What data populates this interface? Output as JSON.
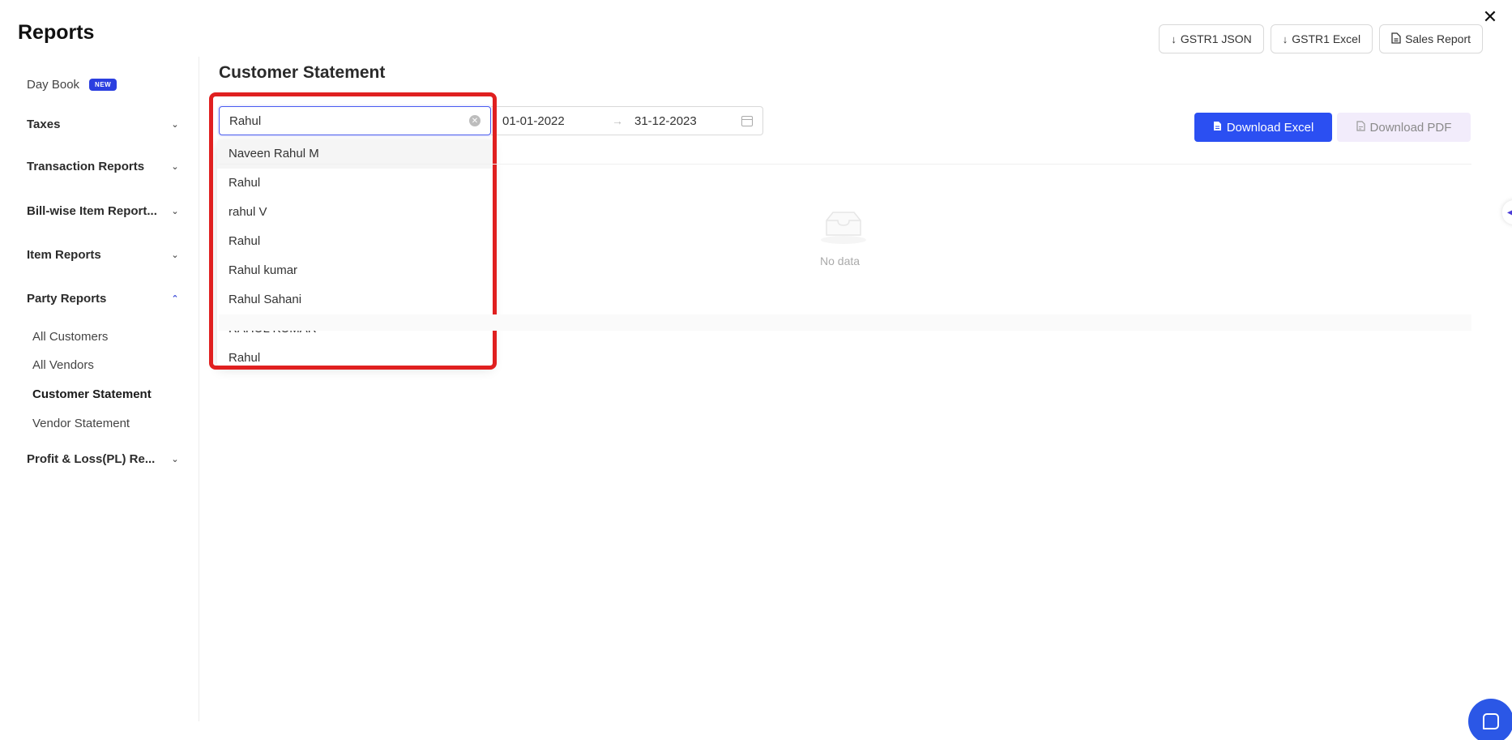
{
  "header": {
    "title": "Reports",
    "close_symbol": "✕",
    "actions": [
      {
        "label": "GSTR1 JSON",
        "icon": "download-arrow-icon"
      },
      {
        "label": "GSTR1 Excel",
        "icon": "download-arrow-icon"
      },
      {
        "label": "Sales Report",
        "icon": "document-icon"
      }
    ]
  },
  "sidebar": {
    "day_book": {
      "label": "Day Book",
      "badge": "NEW"
    },
    "sections": [
      {
        "label": "Taxes",
        "expanded": false
      },
      {
        "label": "Transaction Reports",
        "expanded": false
      },
      {
        "label": "Bill-wise Item Report...",
        "expanded": false
      },
      {
        "label": "Item Reports",
        "expanded": false
      },
      {
        "label": "Party Reports",
        "expanded": true
      },
      {
        "label": "Profit & Loss(PL) Re...",
        "expanded": false
      }
    ],
    "party_items": [
      {
        "label": "All Customers",
        "active": false
      },
      {
        "label": "All Vendors",
        "active": false
      },
      {
        "label": "Customer Statement",
        "active": true
      },
      {
        "label": "Vendor Statement",
        "active": false
      }
    ]
  },
  "main": {
    "title": "Customer Statement",
    "search": {
      "value": "Rahul"
    },
    "date_range": {
      "start": "01-01-2022",
      "separator": "→",
      "end": "31-12-2023"
    },
    "dropdown_options": [
      "Naveen Rahul M",
      "Rahul",
      "rahul V",
      "Rahul",
      "Rahul kumar",
      "Rahul Sahani",
      "RAHUL KUMAR",
      "Rahul"
    ],
    "download_excel": "Download Excel",
    "download_pdf": "Download PDF",
    "empty_text": "No data"
  },
  "colors": {
    "primary": "#2b4ff2",
    "highlight": "#e02020",
    "new_badge": "#2b3fe0",
    "pdf_button_bg": "#f2ecfb"
  }
}
